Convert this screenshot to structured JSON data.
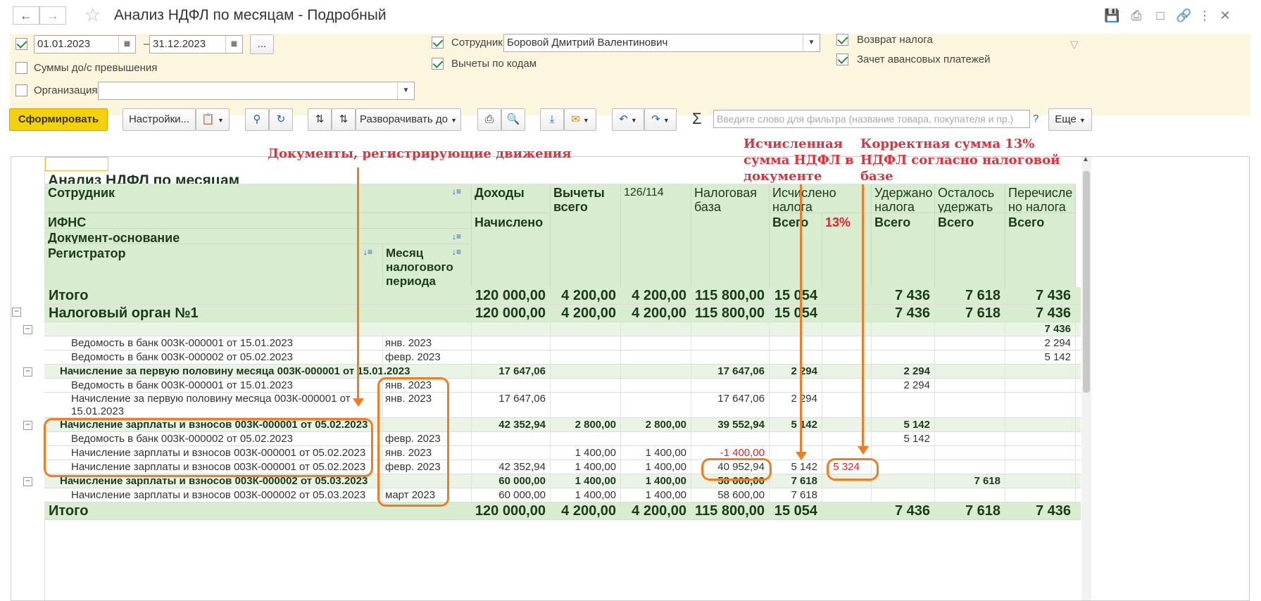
{
  "window": {
    "title": "Анализ НДФЛ по месяцам - Подробный"
  },
  "filters": {
    "period_from": "01.01.2023",
    "period_dash": "–",
    "period_to": "31.12.2023",
    "period_more": "...",
    "sums_label": "Суммы до/с превышения",
    "org_label": "Организация:",
    "org_value": "",
    "employee_label": "Сотрудник:",
    "employee_value": "Боровой Дмитрий Валентинович",
    "deductions_label": "Вычеты по кодам",
    "tax_return_label": "Возврат налога",
    "advance_label": "Зачет авансовых платежей"
  },
  "toolbar": {
    "generate": "Сформировать",
    "settings": "Настройки...",
    "expand": "Разворачивать до",
    "search_placeholder": "Введите слово для фильтра (название товара, покупателя и пр.)",
    "help": "?",
    "more": "Еще"
  },
  "report": {
    "title": "Анализ НДФЛ по месяцам",
    "headers": {
      "employee": "Сотрудник",
      "ifns": "ИФНС",
      "doc_basis": "Документ-основание",
      "registrar": "Регистратор",
      "month": "Месяц налогового периода",
      "income": "Доходы",
      "accrued": "Начислено",
      "deductions": "Вычеты всего",
      "code": "126/114",
      "tax_base": "Налоговая база",
      "calc_tax": "Исчислено налога",
      "total": "Всего",
      "pct13": "13%",
      "withheld": "Удержано налога",
      "withheld_total": "Всего",
      "remaining": "Осталось удержать",
      "remaining_total": "Всего",
      "transferred": "Перечисле но налога",
      "transferred_total": "Всего"
    },
    "rows": [
      {
        "type": "gtot",
        "label": "Итого",
        "month": "",
        "income": "120 000,00",
        "ded": "4 200,00",
        "code": "4 200,00",
        "base": "115 800,00",
        "calc": "15 054",
        "pct": "",
        "with": "7 436",
        "rem": "7 618",
        "trans": "7 436"
      },
      {
        "type": "gtot",
        "label": "Налоговый орган №1",
        "month": "",
        "income": "120 000,00",
        "ded": "4 200,00",
        "code": "4 200,00",
        "base": "115 800,00",
        "calc": "15 054",
        "pct": "",
        "with": "7 436",
        "rem": "7 618",
        "trans": "7 436"
      },
      {
        "type": "grp",
        "label": "",
        "month": "",
        "income": "",
        "ded": "",
        "code": "",
        "base": "",
        "calc": "",
        "pct": "",
        "with": "",
        "rem": "",
        "trans": "7 436"
      },
      {
        "type": "row",
        "label": "Ведомость в банк 003К-000001 от 15.01.2023",
        "month": "янв. 2023",
        "income": "",
        "ded": "",
        "code": "",
        "base": "",
        "calc": "",
        "pct": "",
        "with": "",
        "rem": "",
        "trans": "2 294"
      },
      {
        "type": "row",
        "label": "Ведомость в банк 003К-000002 от 05.02.2023",
        "month": "февр. 2023",
        "income": "",
        "ded": "",
        "code": "",
        "base": "",
        "calc": "",
        "pct": "",
        "with": "",
        "rem": "",
        "trans": "5 142"
      },
      {
        "type": "grp",
        "label": "Начисление за первую половину месяца 003К-000001 от 15.01.2023",
        "month": "",
        "income": "17 647,06",
        "ded": "",
        "code": "",
        "base": "17 647,06",
        "calc": "2 294",
        "pct": "",
        "with": "2 294",
        "rem": "",
        "trans": ""
      },
      {
        "type": "row",
        "label": "Ведомость в банк 003К-000001 от 15.01.2023",
        "month": "янв. 2023",
        "income": "",
        "ded": "",
        "code": "",
        "base": "",
        "calc": "",
        "pct": "",
        "with": "2 294",
        "rem": "",
        "trans": ""
      },
      {
        "type": "row2",
        "label": "Начисление за первую половину месяца 003К-000001 от",
        "label2": "15.01.2023",
        "month": "янв. 2023",
        "income": "17 647,06",
        "ded": "",
        "code": "",
        "base": "17 647,06",
        "calc": "2 294",
        "pct": "",
        "with": "",
        "rem": "",
        "trans": ""
      },
      {
        "type": "grp",
        "label": "Начисление зарплаты и взносов 003К-000001 от 05.02.2023",
        "month": "",
        "income": "42 352,94",
        "ded": "2 800,00",
        "code": "2 800,00",
        "base": "39 552,94",
        "calc": "5 142",
        "pct": "",
        "with": "5 142",
        "rem": "",
        "trans": ""
      },
      {
        "type": "row",
        "label": "Ведомость в банк 003К-000002 от 05.02.2023",
        "month": "февр. 2023",
        "income": "",
        "ded": "",
        "code": "",
        "base": "",
        "calc": "",
        "pct": "",
        "with": "5 142",
        "rem": "",
        "trans": ""
      },
      {
        "type": "row",
        "label": "Начисление зарплаты и взносов 003К-000001 от 05.02.2023",
        "month": "янв. 2023",
        "income": "",
        "ded": "1 400,00",
        "code": "1 400,00",
        "base": "-1 400,00",
        "calc": "",
        "pct": "",
        "with": "",
        "rem": "",
        "trans": "",
        "baseRed": true
      },
      {
        "type": "row",
        "label": "Начисление зарплаты и взносов 003К-000001 от 05.02.2023",
        "month": "февр. 2023",
        "income": "42 352,94",
        "ded": "1 400,00",
        "code": "1 400,00",
        "base": "40 952,94",
        "calc": "5 142",
        "pct": "5 324",
        "with": "",
        "rem": "",
        "trans": ""
      },
      {
        "type": "grp",
        "label": "Начисление зарплаты и взносов 003К-000002 от 05.03.2023",
        "month": "",
        "income": "60 000,00",
        "ded": "1 400,00",
        "code": "1 400,00",
        "base": "58 600,00",
        "calc": "7 618",
        "pct": "",
        "with": "",
        "rem": "7 618",
        "trans": ""
      },
      {
        "type": "row",
        "label": "Начисление зарплаты и взносов 003К-000002 от 05.03.2023",
        "month": "март 2023",
        "income": "60 000,00",
        "ded": "1 400,00",
        "code": "1 400,00",
        "base": "58 600,00",
        "calc": "7 618",
        "pct": "",
        "with": "",
        "rem": "",
        "trans": ""
      },
      {
        "type": "gtot",
        "label": "Итого",
        "month": "",
        "income": "120 000,00",
        "ded": "4 200,00",
        "code": "4 200,00",
        "base": "115 800,00",
        "calc": "15 054",
        "pct": "",
        "with": "7 436",
        "rem": "7 618",
        "trans": "7 436"
      }
    ]
  },
  "annotations": {
    "docs": "Документы, регистрирующие движения",
    "calc_line1": "Исчисленная",
    "calc_line2": "сумма НДФЛ в",
    "calc_line3": "документе",
    "correct_line1": "Корректная сумма 13%",
    "correct_line2": "НДФЛ согласно налоговой",
    "correct_line3": "базе"
  },
  "colors": {
    "accent": "#f07d23",
    "annotation": "#e0303a",
    "header_bg": "#d8ecd0",
    "button_yellow": "#f5d10a"
  }
}
